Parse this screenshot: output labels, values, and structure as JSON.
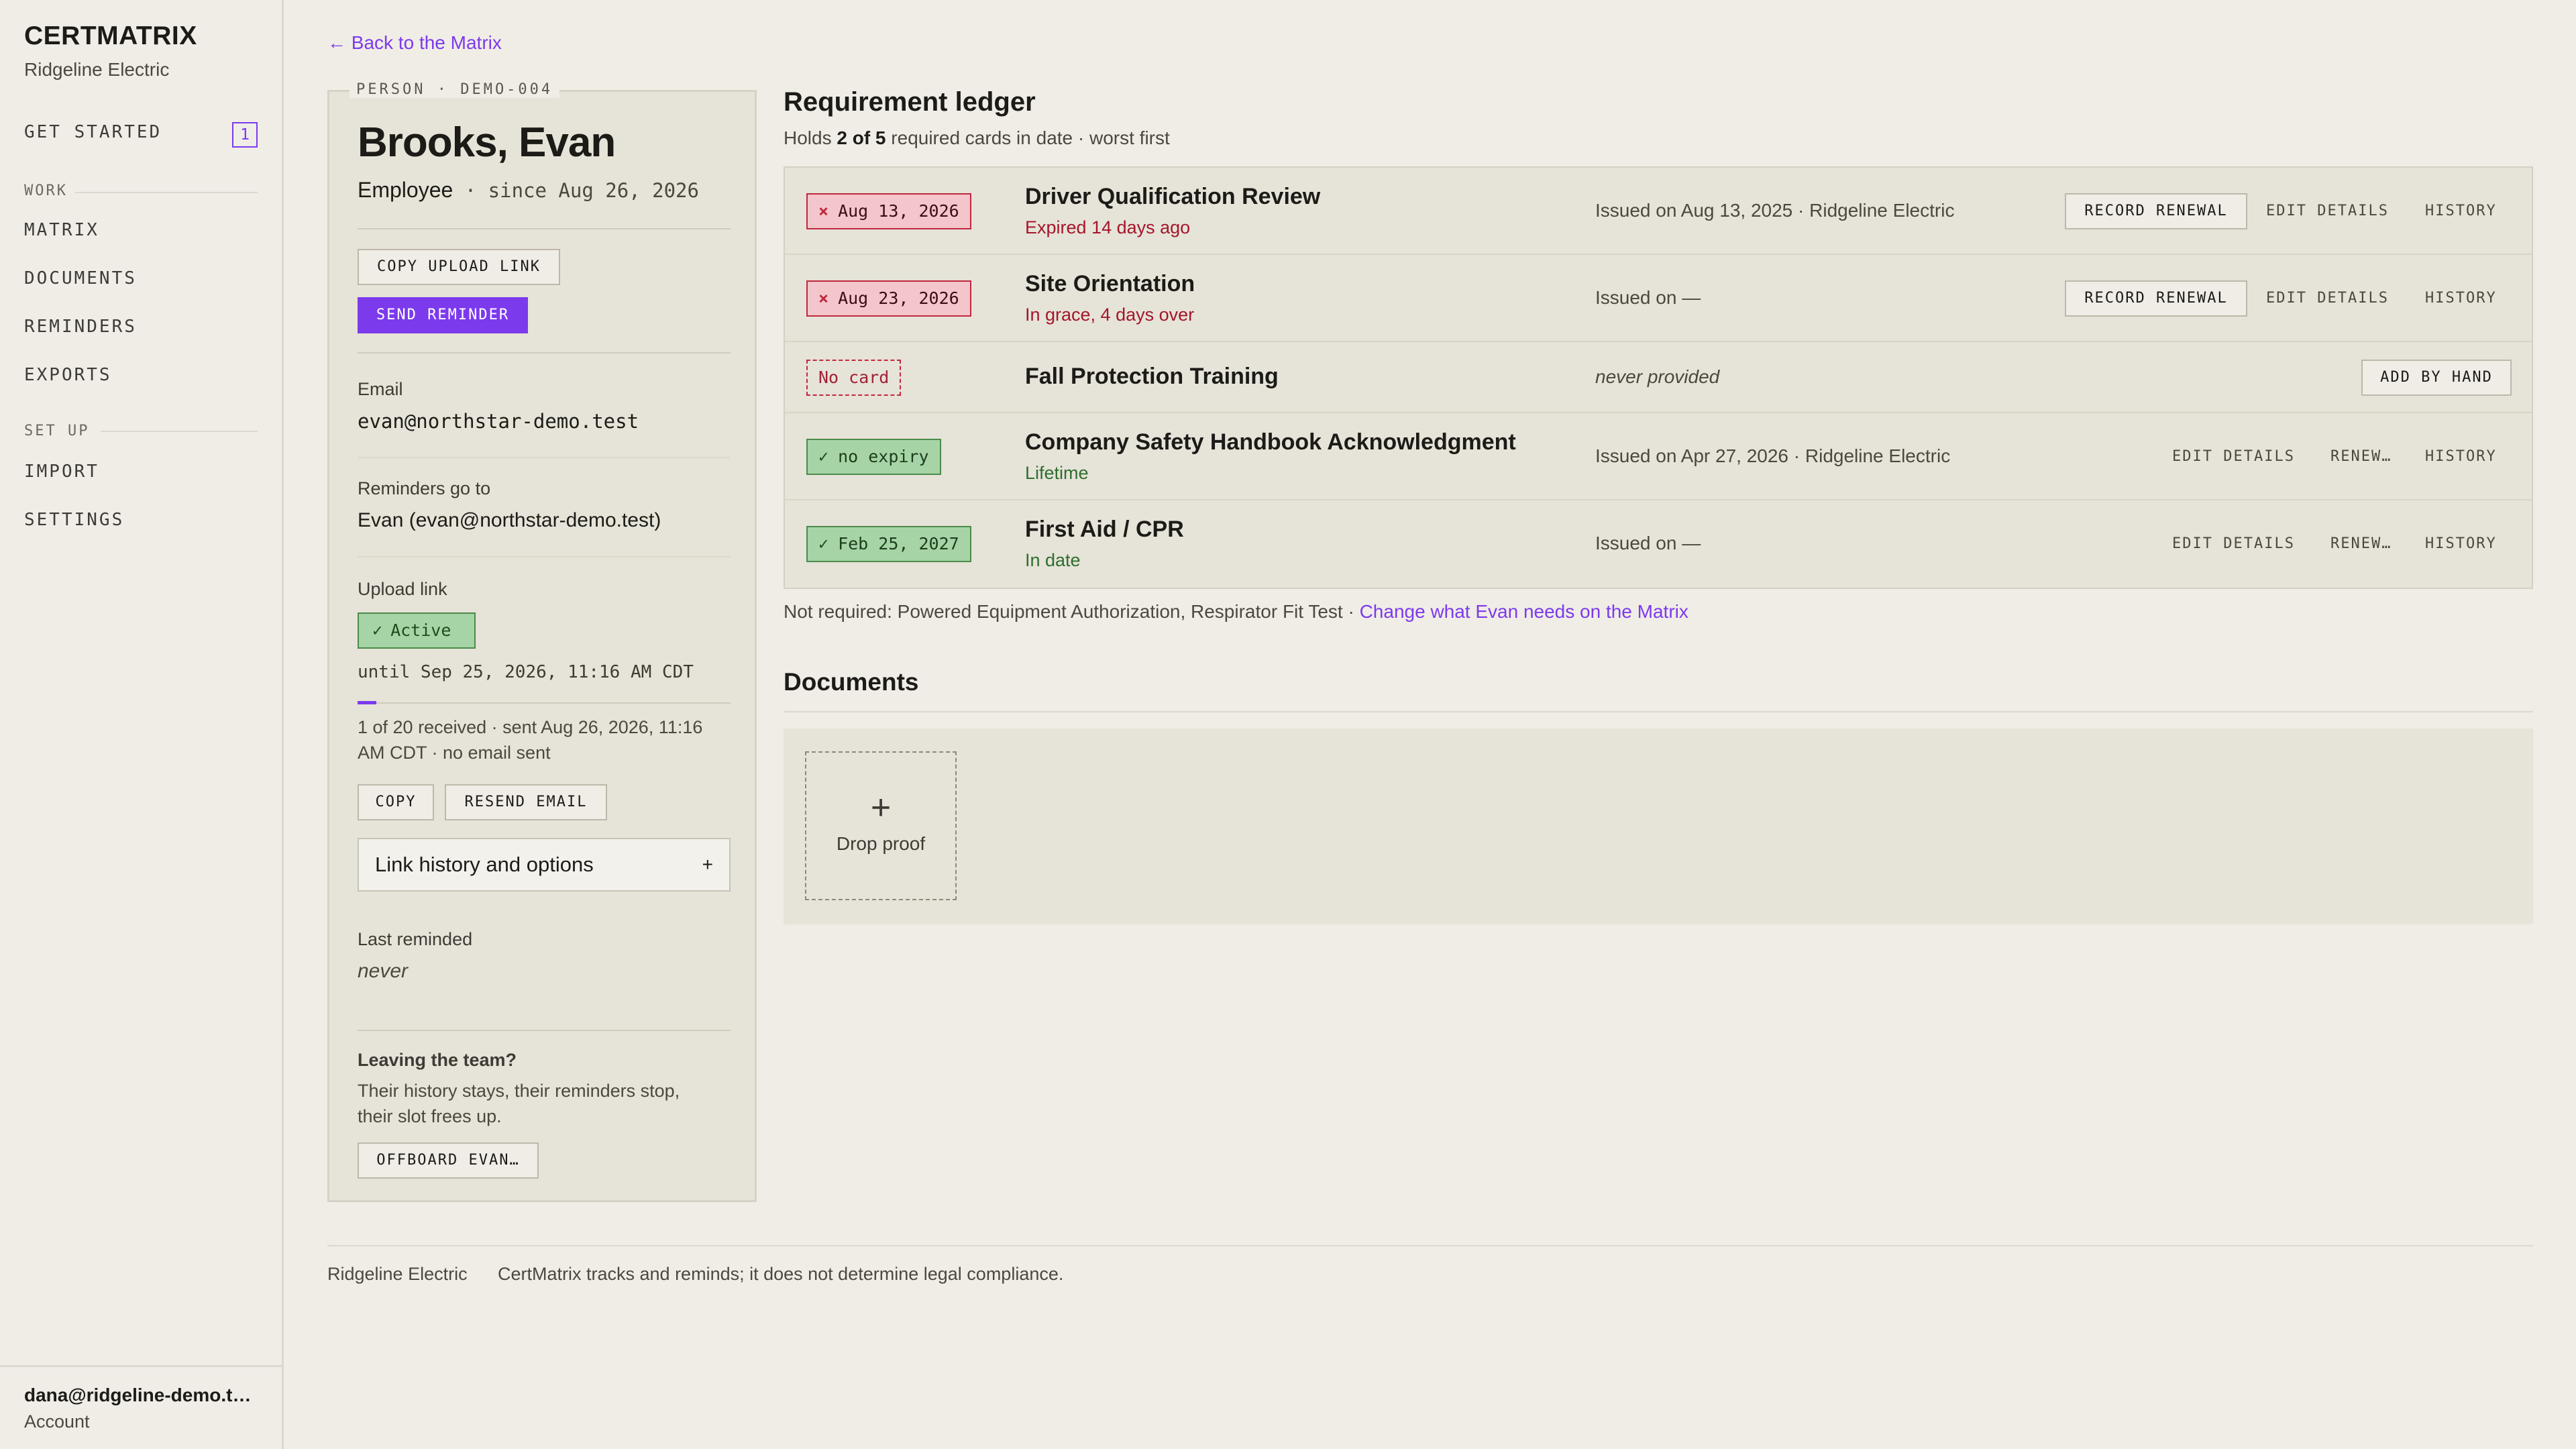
{
  "app": {
    "brand": "CERTMATRIX",
    "org": "Ridgeline Electric"
  },
  "sidebar": {
    "get_started": {
      "label": "GET STARTED",
      "badge": "1"
    },
    "sections": [
      {
        "title": "WORK",
        "items": [
          "MATRIX",
          "DOCUMENTS",
          "REMINDERS",
          "EXPORTS"
        ]
      },
      {
        "title": "SET UP",
        "items": [
          "IMPORT",
          "SETTINGS"
        ]
      }
    ],
    "account": {
      "email": "dana@ridgeline-demo.t…",
      "label": "Account"
    }
  },
  "back_link": "Back to the Matrix",
  "person": {
    "tag": "PERSON · DEMO-004",
    "name": "Brooks, Evan",
    "role": "Employee",
    "since": " · since Aug 26, 2026",
    "buttons": {
      "copy_upload_link": "COPY UPLOAD LINK",
      "send_reminder": "SEND REMINDER"
    },
    "email_label": "Email",
    "email": "evan@northstar-demo.test",
    "reminders_label": "Reminders go to",
    "reminders_to": "Evan (evan@northstar-demo.test)",
    "upload_label": "Upload link",
    "upload_status": "Active",
    "upload_until": "until Sep 25, 2026, 11:16 AM CDT",
    "upload_progress": 0.05,
    "upload_info_line1": "1 of 20 received · sent Aug 26, 2026, 11:16",
    "upload_info_line2": "AM CDT · no email sent",
    "copy_btn": "COPY",
    "resend_btn": "RESEND EMAIL",
    "link_history": "Link history and options",
    "link_history_toggle": "+",
    "last_reminded_label": "Last reminded",
    "last_reminded": "never",
    "leaving_title": "Leaving the team?",
    "leaving_line1": "Their history stays, their reminders stop,",
    "leaving_line2": "their slot frees up.",
    "offboard_btn": "OFFBOARD EVAN…"
  },
  "ledger": {
    "title": "Requirement ledger",
    "subtitle_pre": "Holds ",
    "subtitle_bold": "2 of 5",
    "subtitle_post": " required cards in date · worst first",
    "rows": [
      {
        "status": "Aug 13, 2026",
        "status_kind": "expired",
        "status_icon": "×",
        "name": "Driver Qualification Review",
        "sub": "Expired 14 days ago",
        "issued": "Issued on Aug 13, 2025 · Ridgeline Electric",
        "actions": [
          "RECORD RENEWAL",
          "EDIT DETAILS",
          "HISTORY"
        ]
      },
      {
        "status": "Aug 23, 2026",
        "status_kind": "expired",
        "status_icon": "×",
        "name": "Site Orientation",
        "sub": "In grace, 4 days over",
        "issued": "Issued on —",
        "actions": [
          "RECORD RENEWAL",
          "EDIT DETAILS",
          "HISTORY"
        ]
      },
      {
        "status": "No card",
        "status_kind": "none",
        "status_icon": "",
        "name": "Fall Protection Training",
        "sub": "",
        "issued": "never provided",
        "actions": [
          "ADD BY HAND"
        ]
      },
      {
        "status": "no expiry",
        "status_kind": "ok",
        "status_icon": "✓",
        "name": "Company Safety Handbook Acknowledgment",
        "sub": "Lifetime",
        "issued": "Issued on Apr 27, 2026 · Ridgeline Electric",
        "actions": [
          "EDIT DETAILS",
          "RENEW…",
          "HISTORY"
        ]
      },
      {
        "status": "Feb 25, 2027",
        "status_kind": "ok",
        "status_icon": "✓",
        "name": "First Aid / CPR",
        "sub": "In date",
        "issued": "Issued on —",
        "actions": [
          "EDIT DETAILS",
          "RENEW…",
          "HISTORY"
        ]
      }
    ],
    "not_required": "Not required: Powered Equipment Authorization, Respirator Fit Test · ",
    "change_link": "Change what Evan needs on the Matrix"
  },
  "documents": {
    "title": "Documents",
    "drop_plus": "+",
    "drop_label": "Drop proof"
  },
  "footer": {
    "org": "Ridgeline Electric",
    "note": "CertMatrix tracks and reminds; it does not determine legal compliance."
  },
  "colors": {
    "accent": "#7c3aed",
    "expired": "#c0283e",
    "ok": "#4b8b4b",
    "background": "#f0ede6",
    "panel": "#e6e3d8"
  }
}
